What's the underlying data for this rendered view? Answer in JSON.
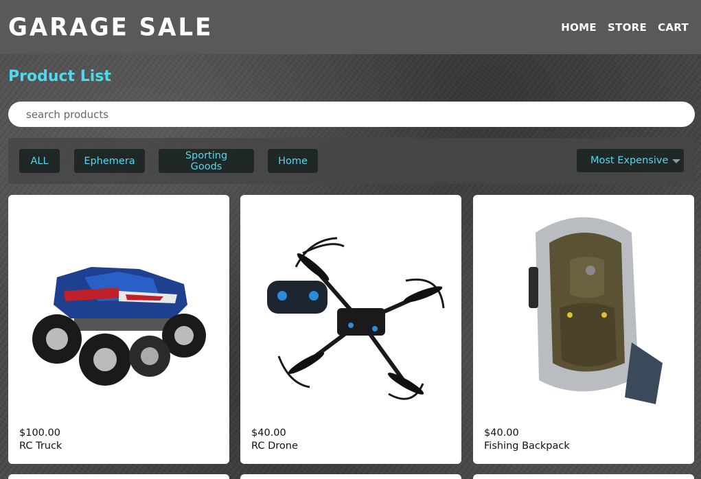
{
  "header": {
    "brand": "GARAGE SALE",
    "nav": [
      {
        "label": "HOME"
      },
      {
        "label": "STORE"
      },
      {
        "label": "CART"
      }
    ]
  },
  "main": {
    "title": "Product List",
    "search": {
      "placeholder": "search products",
      "value": ""
    },
    "filters": [
      {
        "label": "ALL"
      },
      {
        "label": "Ephemera"
      },
      {
        "label": "Sporting Goods"
      },
      {
        "label": "Home"
      }
    ],
    "sort": {
      "selected": "Most Expensive"
    },
    "products": [
      {
        "price": "$100.00",
        "name": "RC Truck",
        "icon": "rc-truck-image"
      },
      {
        "price": "$40.00",
        "name": "RC Drone",
        "icon": "rc-drone-image"
      },
      {
        "price": "$40.00",
        "name": "Fishing Backpack",
        "icon": "backpack-image"
      }
    ]
  },
  "colors": {
    "accent": "#4fd9ee",
    "navbar": "#595959",
    "chip_bg": "#1f2727"
  }
}
